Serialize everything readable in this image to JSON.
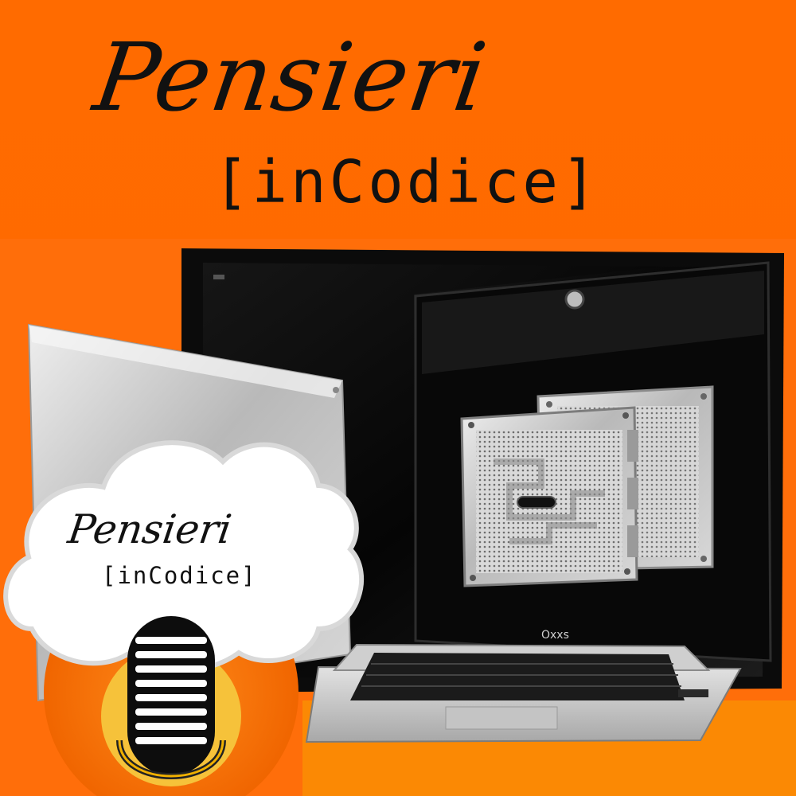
{
  "header": {
    "title_script": "Pensieri",
    "title_mono": "[inCodice]"
  },
  "badge": {
    "title_script": "Pensieri",
    "title_mono": "[inCodice]"
  },
  "laptop": {
    "brand_text": "Oxxs"
  },
  "colors": {
    "background": "#ff6a00",
    "text": "#111111",
    "cloud": "#ffffff",
    "mic_circle": "#f57400",
    "mic_glow": "#f7c030"
  },
  "icons": [
    "microphone-icon",
    "cloud-badge",
    "monitor",
    "laptop",
    "server-module"
  ]
}
